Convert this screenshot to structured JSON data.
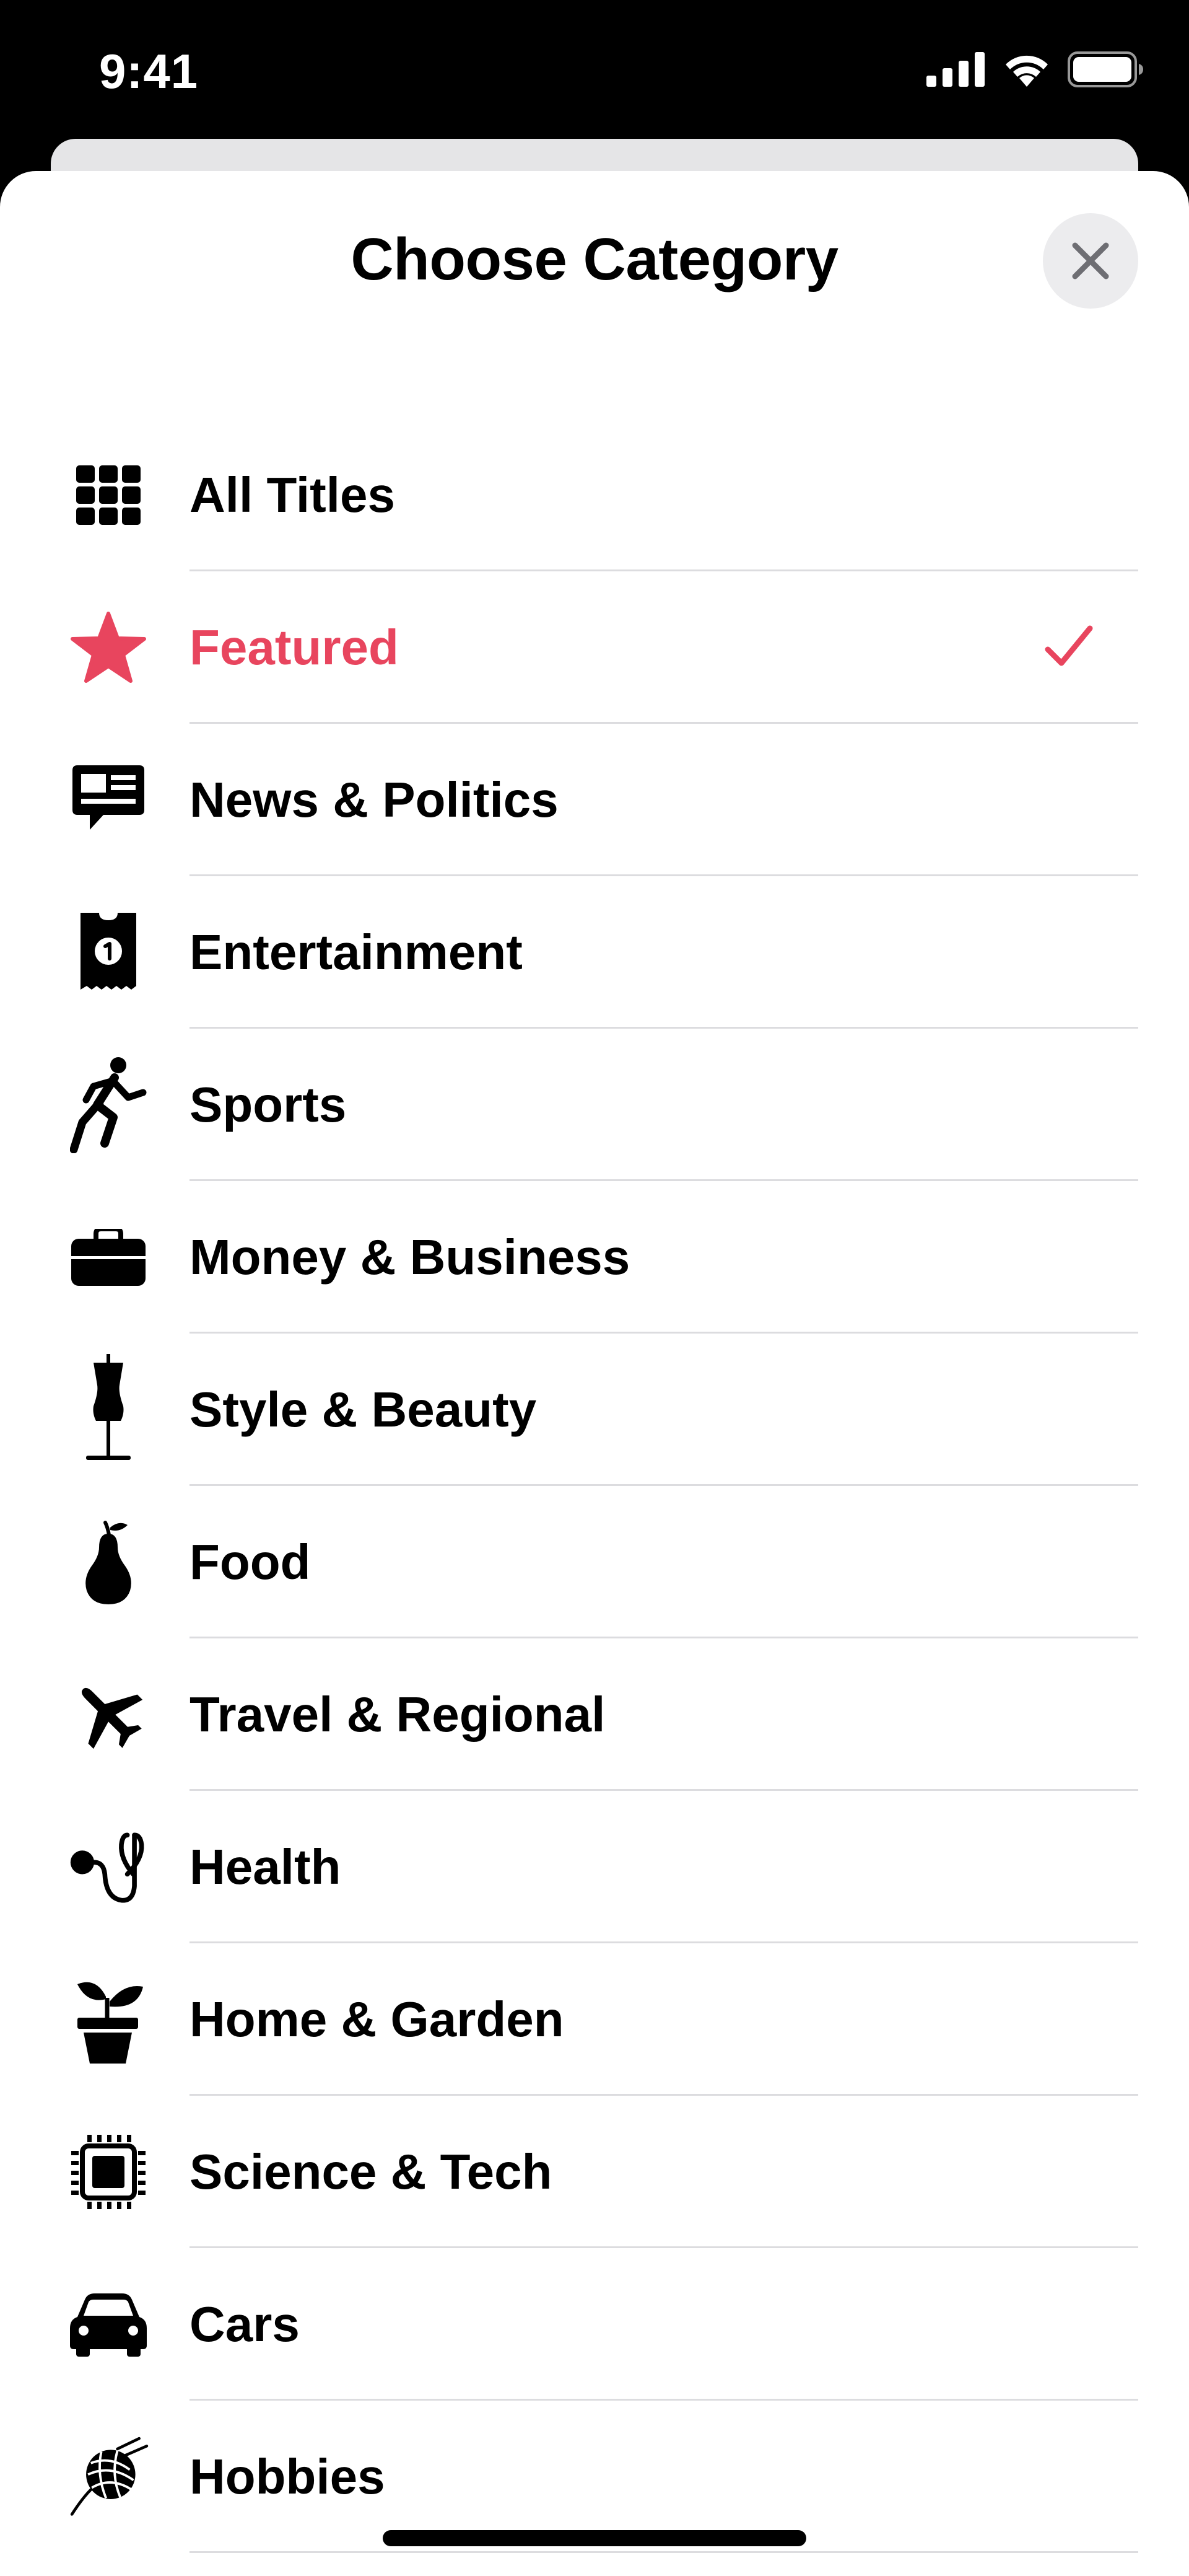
{
  "status_bar": {
    "time": "9:41"
  },
  "sheet": {
    "title": "Choose Category",
    "close_icon": "close-icon"
  },
  "colors": {
    "accent": "#e8455e",
    "text": "#000000",
    "divider": "#dcdcdf",
    "close_bg": "#ececee"
  },
  "categories": [
    {
      "label": "All Titles",
      "icon": "grid-icon",
      "selected": false
    },
    {
      "label": "Featured",
      "icon": "star-icon",
      "selected": true
    },
    {
      "label": "News & Politics",
      "icon": "newspaper-icon",
      "selected": false
    },
    {
      "label": "Entertainment",
      "icon": "ticket-icon",
      "selected": false
    },
    {
      "label": "Sports",
      "icon": "running-figure-icon",
      "selected": false
    },
    {
      "label": "Money & Business",
      "icon": "briefcase-icon",
      "selected": false
    },
    {
      "label": "Style & Beauty",
      "icon": "mannequin-icon",
      "selected": false
    },
    {
      "label": "Food",
      "icon": "pear-icon",
      "selected": false
    },
    {
      "label": "Travel & Regional",
      "icon": "airplane-icon",
      "selected": false
    },
    {
      "label": "Health",
      "icon": "stethoscope-icon",
      "selected": false
    },
    {
      "label": "Home & Garden",
      "icon": "potted-plant-icon",
      "selected": false
    },
    {
      "label": "Science & Tech",
      "icon": "cpu-chip-icon",
      "selected": false
    },
    {
      "label": "Cars",
      "icon": "car-icon",
      "selected": false
    },
    {
      "label": "Hobbies",
      "icon": "yarn-ball-icon",
      "selected": false
    }
  ]
}
